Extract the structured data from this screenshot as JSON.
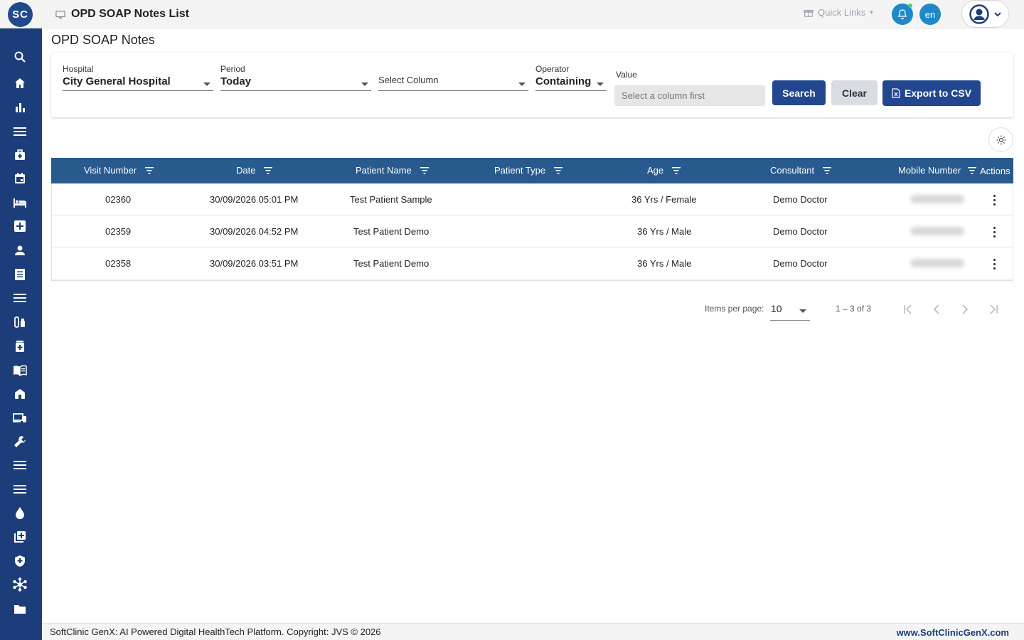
{
  "app": {
    "logo_text": "SC",
    "title": "OPD SOAP Notes List",
    "quick_links": "Quick Links",
    "language": "en"
  },
  "sidebar": {
    "items": [
      {
        "icon": "search-icon"
      },
      {
        "icon": "home-icon"
      },
      {
        "icon": "bar-chart-icon"
      },
      {
        "icon": "menu-icon"
      },
      {
        "icon": "medical-bag-icon"
      },
      {
        "icon": "calendar-icon"
      },
      {
        "icon": "bed-icon"
      },
      {
        "icon": "add-box-icon"
      },
      {
        "icon": "person-icon"
      },
      {
        "icon": "receipt-icon"
      },
      {
        "icon": "list-icon"
      },
      {
        "icon": "lab-icon"
      },
      {
        "icon": "pharmacy-icon"
      },
      {
        "icon": "book-icon"
      },
      {
        "icon": "store-icon"
      },
      {
        "icon": "devices-icon"
      },
      {
        "icon": "wrench-icon"
      },
      {
        "icon": "lines-icon"
      },
      {
        "icon": "lines-icon"
      },
      {
        "icon": "blood-drop-icon"
      },
      {
        "icon": "library-add-icon"
      },
      {
        "icon": "shield-icon"
      },
      {
        "icon": "hub-icon"
      },
      {
        "icon": "folder-icon"
      }
    ]
  },
  "page": {
    "title": "OPD SOAP Notes"
  },
  "filters": {
    "hospital_label": "Hospital",
    "hospital_value": "City General Hospital",
    "period_label": "Period",
    "period_value": "Today",
    "column_placeholder": "Select Column",
    "operator_label": "Operator",
    "operator_value": "Containing",
    "value_label": "Value",
    "value_placeholder": "Select a column first",
    "search_button": "Search",
    "clear_button": "Clear",
    "export_button": "Export to CSV"
  },
  "table": {
    "headers": [
      "Visit Number",
      "Date",
      "Patient Name",
      "Patient Type",
      "Age",
      "Consultant",
      "Mobile Number",
      "Actions"
    ],
    "rows": [
      {
        "visit": "02360",
        "date": "30/09/2026 05:01 PM",
        "patient": "Test Patient Sample",
        "type": "",
        "age": "36 Yrs / Female",
        "consultant": "Demo Doctor"
      },
      {
        "visit": "02359",
        "date": "30/09/2026 04:52 PM",
        "patient": "Test Patient Demo",
        "type": "",
        "age": "36 Yrs / Male",
        "consultant": "Demo Doctor"
      },
      {
        "visit": "02358",
        "date": "30/09/2026 03:51 PM",
        "patient": "Test Patient Demo",
        "type": "",
        "age": "36 Yrs / Male",
        "consultant": "Demo Doctor"
      }
    ]
  },
  "paginator": {
    "items_per_page_label": "Items per page:",
    "items_per_page_value": "10",
    "range": "1 – 3 of 3"
  },
  "footer": {
    "copyright": "SoftClinic GenX: AI Powered Digital HealthTech Platform. Copyright: JVS © 2026",
    "website": "www.SoftClinicGenX.com"
  },
  "colors": {
    "sidebar": "#1c3d79",
    "table_header": "#285a8e",
    "primary_button": "#22478f",
    "accent_blue": "#1e88c8"
  }
}
